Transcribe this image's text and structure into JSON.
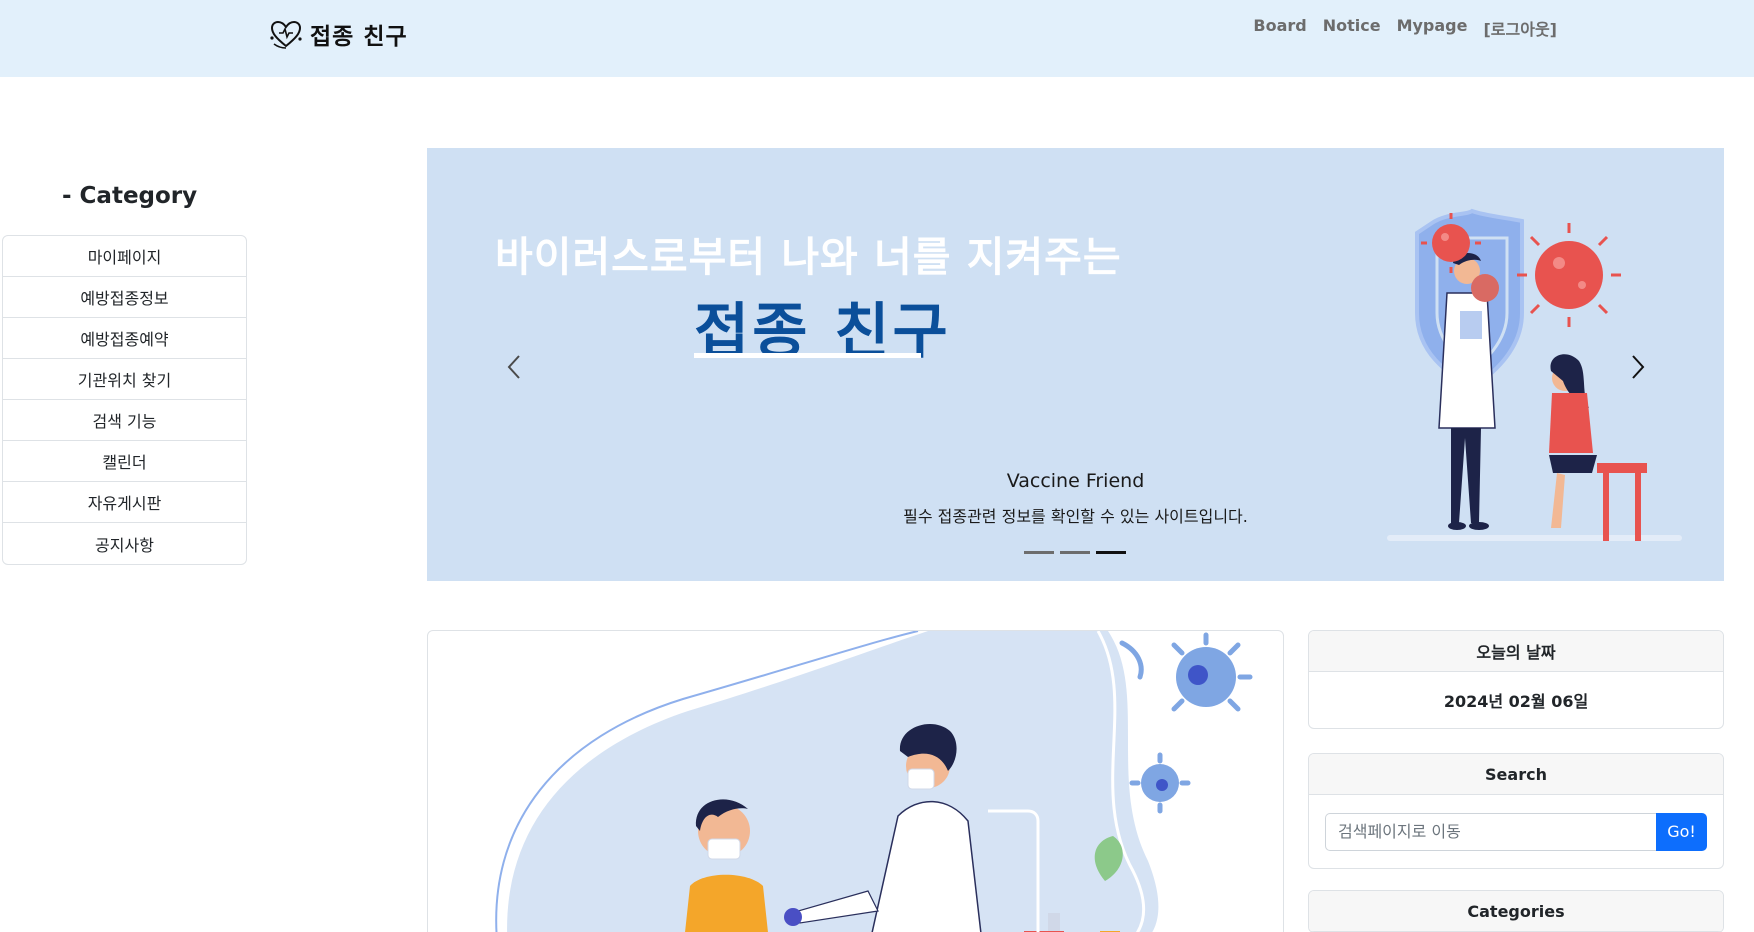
{
  "brand": {
    "name": "접종 친구"
  },
  "nav": {
    "items": [
      "Board",
      "Notice",
      "Mypage",
      "[로그아웃]"
    ]
  },
  "sidebar": {
    "title": "- Category",
    "items": [
      "마이페이지",
      "예방접종정보",
      "예방접종예약",
      "기관위치 찾기",
      "검색 기능",
      "캘린더",
      "자유게시판",
      "공지사항"
    ]
  },
  "carousel": {
    "headline": "바이러스로부터 나와 너를 지켜주는",
    "brand": "접종 친구",
    "caption_title": "Vaccine Friend",
    "caption_sub": "필수 접종관련 정보를 확인할 수 있는 사이트입니다.",
    "slide_count": 3,
    "active_slide": 3,
    "prev_icon": "chevron-left-icon",
    "next_icon": "chevron-right-icon"
  },
  "widgets": {
    "date": {
      "title": "오늘의 날짜",
      "value": "2024년 02월 06일"
    },
    "search": {
      "title": "Search",
      "placeholder": "검색페이지로 이동",
      "button": "Go!"
    },
    "categories": {
      "title": "Categories"
    }
  },
  "colors": {
    "navbar_bg": "#e2f0fb",
    "carousel_bg": "#cfe0f3",
    "brand_blue": "#0b4f9a",
    "primary": "#0d6efd",
    "virus_red": "#e8534f",
    "virus_blue": "#7fa6e3"
  }
}
